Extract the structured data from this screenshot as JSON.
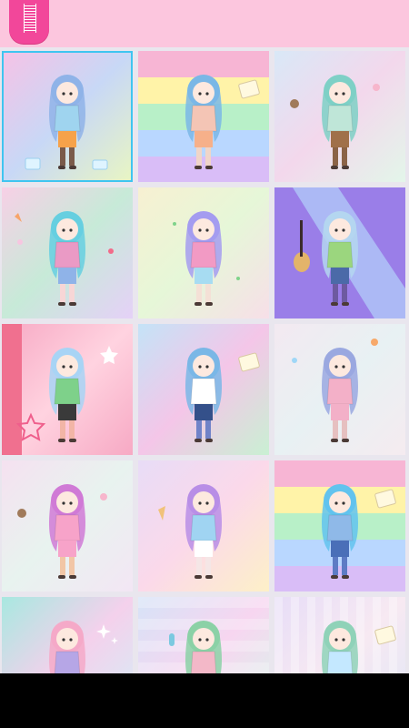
{
  "app": {
    "icons": {
      "menu": "list-icon"
    },
    "colors": {
      "top_bar": "#fcc6de",
      "menu_button": "#f2479a",
      "selection": "#3fc5f0",
      "nav_bar": "#000000"
    }
  },
  "gallery": {
    "selected_index": 0,
    "items": [
      {
        "bg": [
          "#f6c2e6",
          "#c8d8f6",
          "#e9f6c2"
        ],
        "hair": "#8fb3e8",
        "top": "#9fd4ef",
        "bottom": "#f6a24a",
        "legs": "#7a5a4a",
        "prop": "ice-cubes"
      },
      {
        "bg": [
          "#f7b5d4",
          "#fff3a8",
          "#b8f0c8",
          "#b9d7ff",
          "#d9bdf7"
        ],
        "hair": "#7ab7e6",
        "top": "#f4c5b5",
        "bottom": "#f6b08a",
        "legs": "#f0d5c8",
        "prop": "note",
        "stripes": true
      },
      {
        "bg": [
          "#d9e8f7",
          "#f3d8ec",
          "#e3f6ea"
        ],
        "hair": "#7ed0c6",
        "top": "#bfe6d8",
        "bottom": "#a0704a",
        "legs": "#8b6347",
        "prop": "sweets"
      },
      {
        "bg": [
          "#f7d0e6",
          "#c7ead8",
          "#e5d1f7"
        ],
        "hair": "#66cfe0",
        "top": "#ea9ac5",
        "bottom": "#8fb3e8",
        "legs": "#f7d6d6",
        "prop": "stars"
      },
      {
        "bg": [
          "#f7f0d2",
          "#e6f7d8",
          "#f7dfe8"
        ],
        "hair": "#a49cf0",
        "top": "#f29ac4",
        "bottom": "#a7dcf2",
        "legs": "#f4e0d6",
        "prop": "hearts"
      },
      {
        "bg": [
          "#9a7ee8",
          "#b0c8f7",
          "#8c73e0"
        ],
        "hair": "#b4d6f0",
        "top": "#9bd67e",
        "bottom": "#4b6aa8",
        "legs": "#6d5aa0",
        "prop": "guitar",
        "diag": true
      },
      {
        "bg": [
          "#f7a9c4",
          "#ffd3e0",
          "#f7a9c4"
        ],
        "hair": "#a8d4f5",
        "top": "#7ed18a",
        "bottom": "#3a3a3a",
        "legs": "#f2b5a6",
        "prop": "stars-pink",
        "band": true
      },
      {
        "bg": [
          "#c4e3f7",
          "#f4c6e8",
          "#c9f0d3"
        ],
        "hair": "#7ab7e6",
        "top": "#ffffff",
        "bottom": "#34508a",
        "legs": "#7083c8",
        "prop": "note"
      },
      {
        "bg": [
          "#f3e9f1",
          "#e8f1f3",
          "#f5ebf0"
        ],
        "hair": "#9aa8e0",
        "top": "#f3b0c8",
        "bottom": "#f3b0c8",
        "legs": "#e6c0c0",
        "prop": "candy"
      },
      {
        "bg": [
          "#f5e1f0",
          "#e8f3ef",
          "#f3e6f4"
        ],
        "hair": "#d07ad6",
        "top": "#f7a3c9",
        "bottom": "#f7a3c9",
        "legs": "#f2c6a6",
        "prop": "sweets"
      },
      {
        "bg": [
          "#e8dcf7",
          "#fbd9ea",
          "#fdf0c8"
        ],
        "hair": "#b88ee6",
        "top": "#a0d4f2",
        "bottom": "#ffffff",
        "legs": "#f5e6e6",
        "prop": "cone"
      },
      {
        "bg": [
          "#f7b5d4",
          "#fff3a8",
          "#b8f0c8",
          "#b9d7ff",
          "#d9bdf7"
        ],
        "hair": "#62c3ee",
        "top": "#8fb9e8",
        "bottom": "#4a6fb8",
        "legs": "#5e7bc4",
        "prop": "note",
        "stripes": true
      },
      {
        "bg": [
          "#a8e8e0",
          "#f4d1ec",
          "#d2f0f7"
        ],
        "hair": "#f5a9c8",
        "top": "#b6a6e6",
        "bottom": "#3a3a3a",
        "legs": "#e6d6c6",
        "prop": "sparkles"
      },
      {
        "bg": [
          "#d6e3f7",
          "#f7d6f0",
          "#d6f7ea"
        ],
        "hair": "#8bd1a6",
        "top": "#f3b8c8",
        "bottom": "#f3b8c8",
        "legs": "#e6d6c6",
        "prop": "popsicle",
        "checker": true
      },
      {
        "bg": [
          "#e7ddf7",
          "#f7e9f2",
          "#e0e6f7"
        ],
        "hair": "#8fd2b8",
        "top": "#c4e8ff",
        "bottom": "#ffffff",
        "legs": "#f2e0d6",
        "prop": "note",
        "vstripes": true
      }
    ]
  }
}
